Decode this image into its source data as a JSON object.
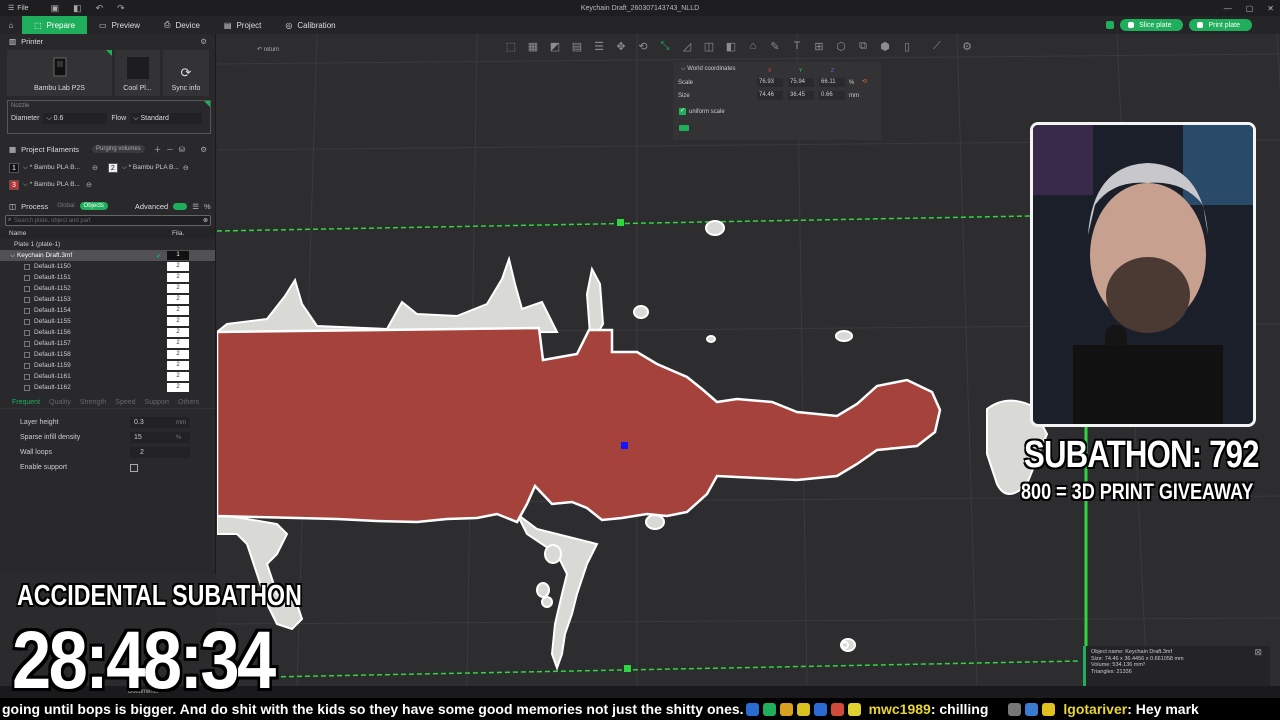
{
  "app": {
    "document_title": "Keychain Draft_260307143743_NLLD",
    "file_menu": "File"
  },
  "tabs": [
    {
      "label": "Prepare"
    },
    {
      "label": "Preview"
    },
    {
      "label": "Device"
    },
    {
      "label": "Project"
    },
    {
      "label": "Calibration"
    }
  ],
  "actions": {
    "slice": "Slice plate",
    "print": "Print plate"
  },
  "printer": {
    "section": "Printer",
    "model": "Bambu Lab P2S",
    "plate": "Cool Pl...",
    "sync": "Sync info",
    "nozzle_label": "Nozzle",
    "diameter_label": "Diameter",
    "diameter_value": "0.6",
    "flow_label": "Flow",
    "flow_value": "Standard"
  },
  "filaments": {
    "section": "Project Filaments",
    "purging": "Purging volumes",
    "items": [
      {
        "num": "1",
        "name": "* Bambu PLA B..."
      },
      {
        "num": "2",
        "name": "* Bambu PLA B..."
      },
      {
        "num": "3",
        "name": "* Bambu PLA B..."
      }
    ]
  },
  "process": {
    "section": "Process",
    "global": "Global",
    "objects": "Objects",
    "advanced": "Advanced",
    "search_placeholder": "Search plate, object and part",
    "col_name": "Name",
    "col_fila": "Fila.",
    "plate": "Plate 1 (plate-1)",
    "object": "Keychain Draft.3mf",
    "object_fila": "1",
    "parts": [
      {
        "name": "Default-1150",
        "fila": "2"
      },
      {
        "name": "Default-1151",
        "fila": "2"
      },
      {
        "name": "Default-1152",
        "fila": "2"
      },
      {
        "name": "Default-1153",
        "fila": "2"
      },
      {
        "name": "Default-1154",
        "fila": "2"
      },
      {
        "name": "Default-1155",
        "fila": "2"
      },
      {
        "name": "Default-1156",
        "fila": "2"
      },
      {
        "name": "Default-1157",
        "fila": "2"
      },
      {
        "name": "Default-1158",
        "fila": "2"
      },
      {
        "name": "Default-1159",
        "fila": "2"
      },
      {
        "name": "Default-1161",
        "fila": "2"
      },
      {
        "name": "Default-1162",
        "fila": "2"
      }
    ],
    "param_tabs": [
      "Frequent",
      "Quality",
      "Strength",
      "Speed",
      "Support",
      "Others"
    ],
    "params": [
      {
        "label": "Layer height",
        "value": "0.3",
        "unit": "mm"
      },
      {
        "label": "Sparse infill density",
        "value": "15",
        "unit": "%"
      },
      {
        "label": "Wall loops",
        "value": "2",
        "unit": ""
      }
    ],
    "support_label": "Enable support"
  },
  "viewport": {
    "return": "return",
    "coords_title": "World coordinates",
    "axes": [
      "X",
      "Y",
      "Z"
    ],
    "scale_label": "Scale",
    "scale": [
      "76.93",
      "75.94",
      "66.11"
    ],
    "scale_unit": "%",
    "size_label": "Size",
    "size": [
      "74.46",
      "36.45",
      "0.66"
    ],
    "size_unit": "mm",
    "uniform": "uniform scale"
  },
  "object_info": {
    "name": "Object name: Keychain Draft.3mf",
    "size": "Size: 74.46 x 36.4456 x 0.661058 mm",
    "volume": "Volume: 534.136 mm³",
    "triangles": "Triangles: 21336"
  },
  "status": {
    "documents": "Documents"
  },
  "overlay": {
    "subathon": "SUBATHON: 792",
    "giveaway": "800 = 3D PRINT GIVEAWAY",
    "accidental": "ACCIDENTAL SUBATHON",
    "timer": "28:48:34"
  },
  "ticker": {
    "msg1": "going until bops is bigger. And do shit with the kids so they have some good memories not just the shitty ones.",
    "user2": "mwc1989",
    "msg2": ": chilling",
    "user3": "lgotariver",
    "msg3": ": Hey mark"
  },
  "colors": {
    "accent": "#1fae5b",
    "part": "#a5423c",
    "bed": "#2d2d30"
  }
}
